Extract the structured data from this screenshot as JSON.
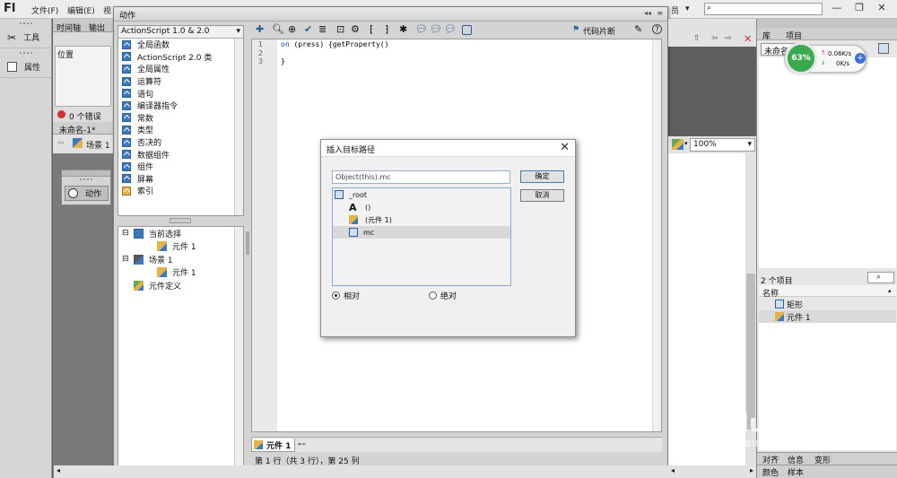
{
  "menubar": {
    "logo": "Fl",
    "items": [
      "文件(F)",
      "编辑(E)",
      "视"
    ],
    "right_partial": "员"
  },
  "left_toolbar": {
    "tools_label": "工具",
    "properties_label": "属性"
  },
  "timeline": {
    "tab_timeline": "时间轴",
    "tab_output": "输出",
    "column_position": "位置",
    "errors": "0 个错误",
    "doc_tab": "未命名-1*",
    "scene": "场景 1",
    "mini_panel_label": "动作"
  },
  "actions": {
    "title": "动作",
    "version_select": "ActionScript 1.0 & 2.0",
    "toolbox_items": [
      "全局函数",
      "ActionScript 2.0 类",
      "全局属性",
      "运算符",
      "语句",
      "编译器指令",
      "常数",
      "类型",
      "否决的",
      "数据组件",
      "组件",
      "屏幕",
      "索引"
    ],
    "tree": [
      {
        "label": "当前选择",
        "indent": 0
      },
      {
        "label": "元件 1",
        "indent": 1
      },
      {
        "label": "场景 1",
        "indent": 0
      },
      {
        "label": "元件 1",
        "indent": 1
      },
      {
        "label": "元件定义",
        "indent": 0
      }
    ],
    "snippets_label": "代码片断",
    "line_numbers": [
      "1",
      "2",
      "3"
    ],
    "code_line1_kw": "on",
    "code_line1_rest": " (press) {getProperty()",
    "code_line3": "}",
    "bottom_tab": "元件 1",
    "status": "第 1 行（共 3 行），第 25 列"
  },
  "dialog": {
    "title": "插入目标路径",
    "path_value": "Object(this).mc",
    "ok": "确定",
    "cancel": "取消",
    "tree": [
      {
        "label": "_root",
        "icon": "movieclip-icon",
        "indent": 0
      },
      {
        "label": "()",
        "icon": "text-icon",
        "indent": 1
      },
      {
        "label": "(元件 1)",
        "icon": "symbol-icon",
        "indent": 1
      },
      {
        "label": "mc",
        "icon": "movieclip-icon",
        "indent": 1
      }
    ],
    "radio_relative": "相对",
    "radio_absolute": "绝对"
  },
  "stage": {
    "zoom": "100%",
    "text": "确定",
    "crosshair": "+"
  },
  "library": {
    "tab_library": "库",
    "tab_project": "项目",
    "doc_select": "未命名-",
    "count": "2 个项目",
    "col_name": "名称",
    "items": [
      {
        "label": "矩形",
        "icon": "shape-icon"
      },
      {
        "label": "元件 1",
        "icon": "symbol-icon"
      }
    ],
    "bottom_tabs_row1": [
      "对齐",
      "信息",
      "变形"
    ],
    "bottom_tabs_row2": [
      "颜色",
      "样本"
    ]
  },
  "netmeter": {
    "percent": "63%",
    "up": "0.06K/s",
    "down": "0K/s"
  },
  "watermark": {
    "text": "Baidu经验",
    "url": "jingyan.baidu.com"
  }
}
